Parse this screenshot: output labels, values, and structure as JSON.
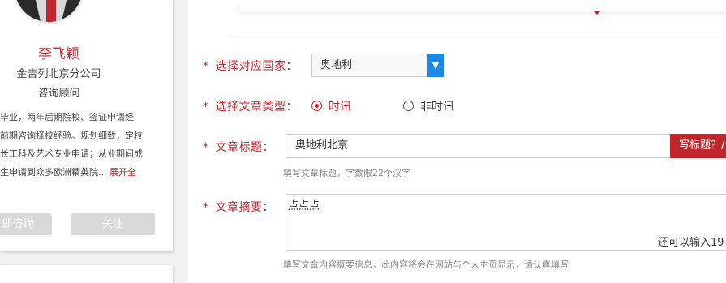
{
  "profile": {
    "name": "李飞颖",
    "company": "金吉列北京分公司",
    "role": "咨询顾问",
    "bio_lines": [
      "毕业，两年后期院校、签证申请经",
      "前期咨询择校经验。规划细致，定校",
      "长工科及艺术专业申请；从业期间成",
      "生申请到众多欧洲精英院..."
    ],
    "bio_more": "展开全",
    "consult_button": "即咨询",
    "follow_button": "关注"
  },
  "form": {
    "country": {
      "label": "选择对应国家：",
      "value": "奥地利"
    },
    "article_type": {
      "label": "选择文章类型：",
      "options": [
        {
          "label": "时讯",
          "checked": true
        },
        {
          "label": "非时讯",
          "checked": false
        }
      ]
    },
    "title": {
      "label": "文章标题：",
      "value": "奥地利北京",
      "button": "写标题？/",
      "hint": "填写文章标题，字数限22个汉字"
    },
    "summary": {
      "label": "文章摘要：",
      "value": "点点点",
      "counter": "还可以输入19",
      "hint": "填写文章内容概要信息，此内容将会在网站与个人主页显示，请认真填写"
    },
    "required_mark": "*"
  },
  "colors": {
    "accent": "#c0262d",
    "select_arrow": "#1e88e5"
  }
}
